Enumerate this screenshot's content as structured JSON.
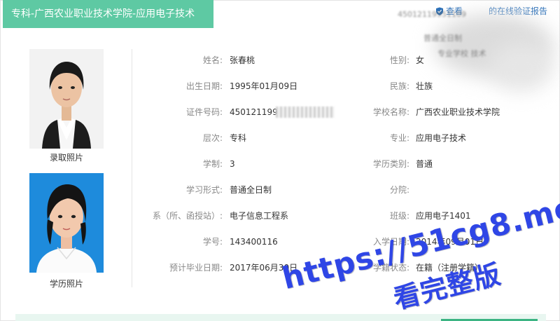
{
  "header": {
    "title": "专科-广西农业职业技术学院-应用电子技术",
    "verify_link": "查看",
    "verify_link_tail": "的在线验证报告"
  },
  "blurred_overlay": {
    "line1": "45012119951109",
    "line2": "普通全日制",
    "line3": "专业学校 技术"
  },
  "photos": {
    "admission_label": "录取照片",
    "education_label": "学历照片"
  },
  "fields": {
    "name": {
      "label": "姓名:",
      "value": "张春桃"
    },
    "gender": {
      "label": "性别:",
      "value": "女"
    },
    "birth": {
      "label": "出生日期:",
      "value": "1995年01月09日"
    },
    "ethnicity": {
      "label": "民族:",
      "value": "壮族"
    },
    "id_number": {
      "label": "证件号码:",
      "value": "450121199"
    },
    "school": {
      "label": "学校名称:",
      "value": "广西农业职业技术学院"
    },
    "level": {
      "label": "层次:",
      "value": "专科"
    },
    "major": {
      "label": "专业:",
      "value": "应用电子技术"
    },
    "duration": {
      "label": "学制:",
      "value": "3"
    },
    "edu_type": {
      "label": "学历类别:",
      "value": "普通"
    },
    "study_form": {
      "label": "学习形式:",
      "value": "普通全日制"
    },
    "branch": {
      "label": "分院:",
      "value": ""
    },
    "department": {
      "label": "系（所、函授站）:",
      "value": "电子信息工程系"
    },
    "class": {
      "label": "班级:",
      "value": "应用电子1401"
    },
    "student_id": {
      "label": "学号:",
      "value": "143400116"
    },
    "enroll_date": {
      "label": "入学日期:",
      "value": "2014年09月01日"
    },
    "grad_date": {
      "label": "预计毕业日期:",
      "value": "2017年06月30日"
    },
    "status": {
      "label": "学籍状态:",
      "value": "在籍（注册学籍）"
    }
  },
  "watermark": {
    "url": "https://51cg8.me",
    "text": "看完整版",
    "color": "#2f46e6"
  },
  "colors": {
    "accent": "#5ec9a3",
    "link": "#2a6fb8"
  }
}
